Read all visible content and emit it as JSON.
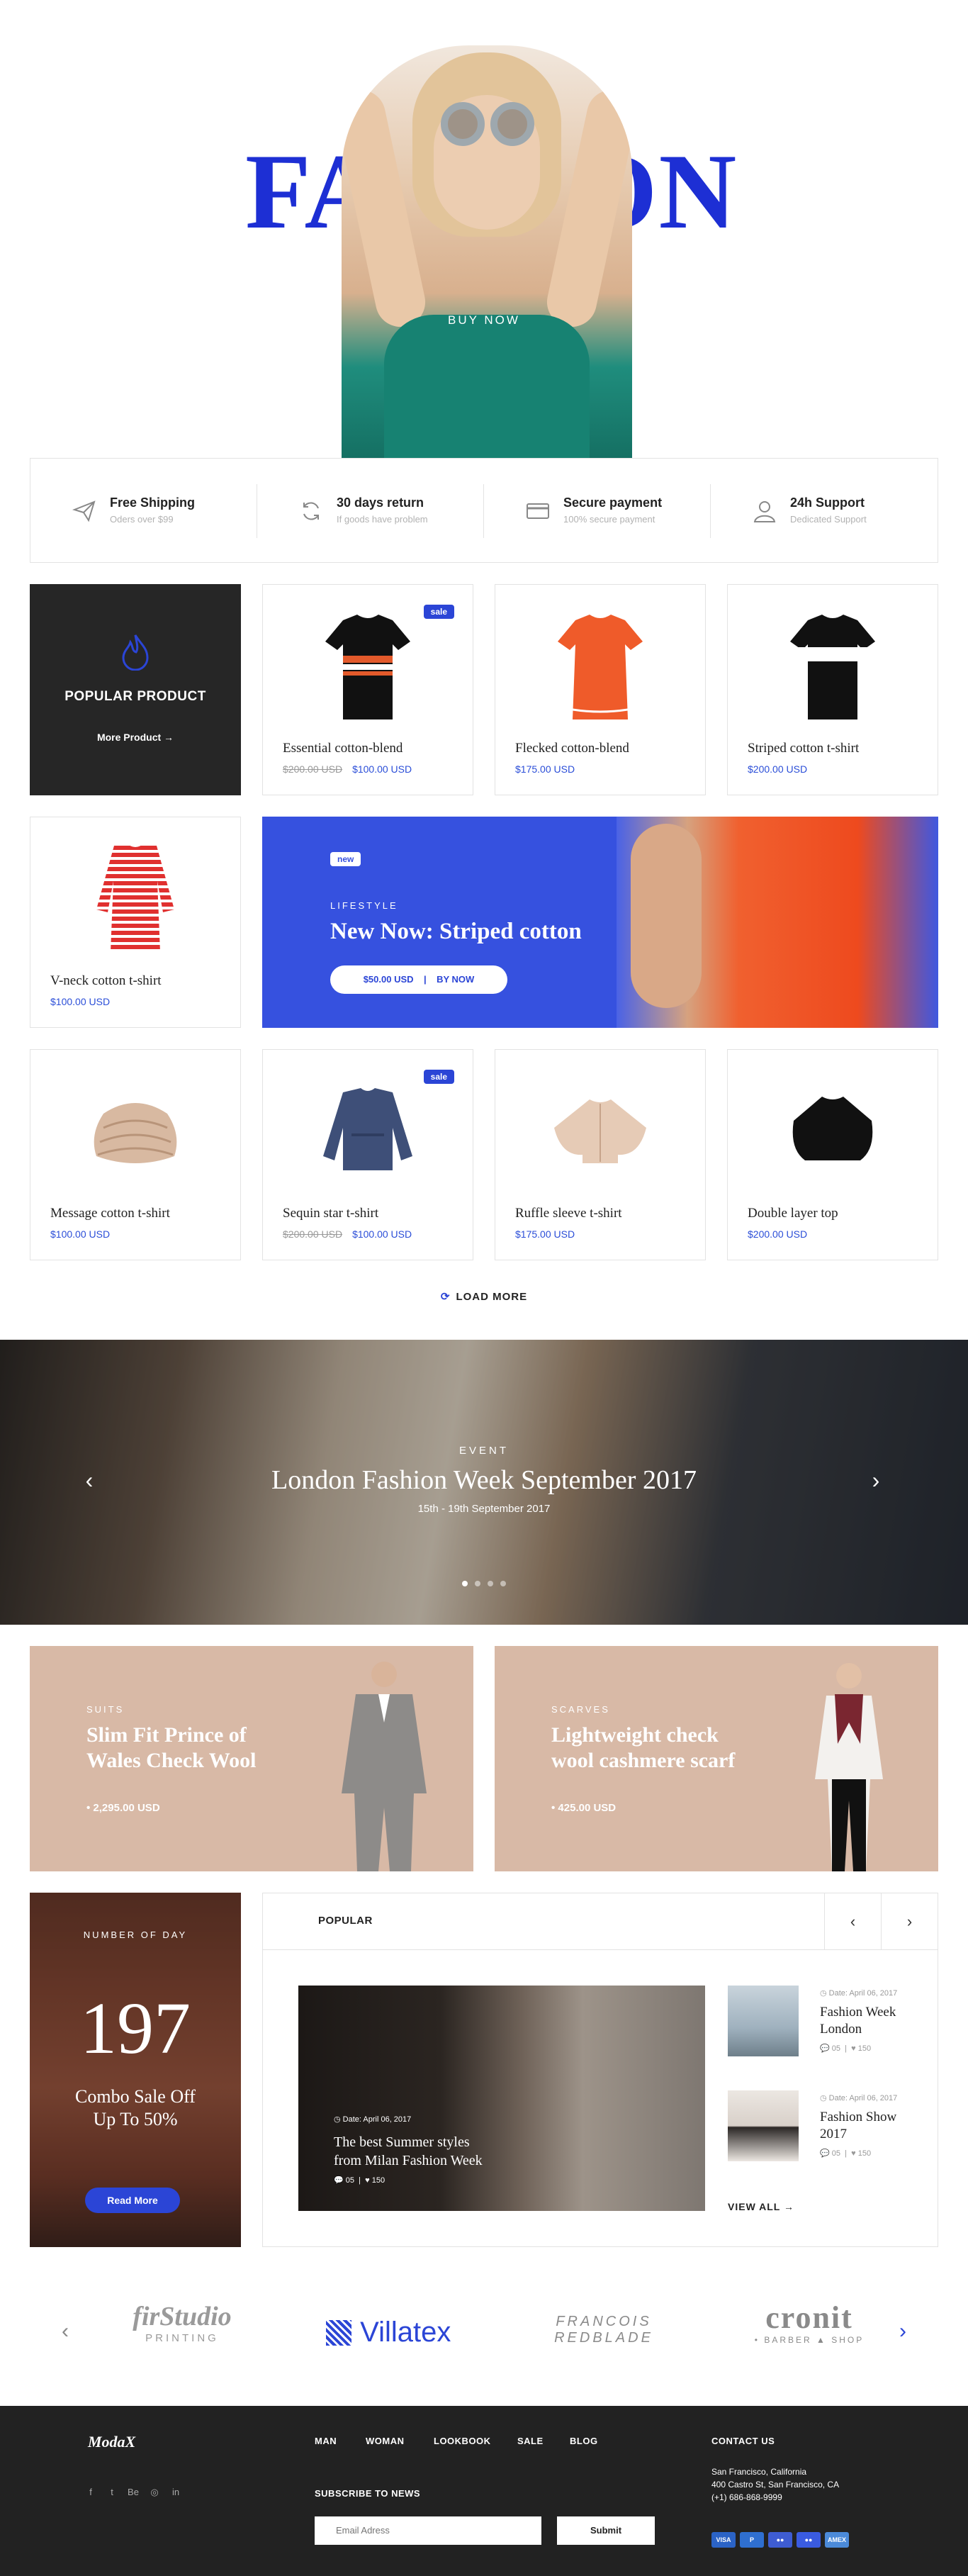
{
  "hero": {
    "word": "FASHION",
    "cta": "BUY NOW"
  },
  "features": [
    {
      "icon": "paper-plane-icon",
      "title": "Free Shipping",
      "sub": "Oders over $99"
    },
    {
      "icon": "refresh-icon",
      "title": "30 days return",
      "sub": "If goods have problem"
    },
    {
      "icon": "credit-card-icon",
      "title": "Secure payment",
      "sub": "100% secure payment"
    },
    {
      "icon": "user-support-icon",
      "title": "24h Support",
      "sub": "Dedicated Support"
    }
  ],
  "popular": {
    "title": "POPULAR PRODUCT",
    "link": "More Product  →"
  },
  "products": [
    {
      "name": "Essential cotton-blend",
      "old": "$200.00 USD",
      "price": "$100.00 USD",
      "badge": "sale",
      "color": "#111111",
      "stripe": "#e35a2b"
    },
    {
      "name": "Flecked cotton-blend",
      "old": "",
      "price": "$175.00 USD",
      "badge": "",
      "color": "#ef5b2a",
      "stripe": "#ef5b2a"
    },
    {
      "name": "Striped cotton t-shirt",
      "old": "",
      "price": "$200.00 USD",
      "badge": "",
      "color": "#111111",
      "stripe": "#ffffff"
    },
    {
      "name": "V-neck cotton t-shirt",
      "old": "",
      "price": "$100.00 USD",
      "badge": "",
      "color": "#e0302f",
      "stripe": "#ffffff"
    },
    {
      "name": "Message cotton t-shirt",
      "old": "",
      "price": "$100.00 USD",
      "badge": "",
      "color": "#d8b9a1",
      "stripe": "#c7a48a"
    },
    {
      "name": "Sequin star t-shirt",
      "old": "$200.00 USD",
      "price": "$100.00 USD",
      "badge": "sale",
      "color": "#3e4f78",
      "stripe": "#2f3d60"
    },
    {
      "name": "Ruffle sleeve t-shirt",
      "old": "",
      "price": "$175.00 USD",
      "badge": "",
      "color": "#e6cbb6",
      "stripe": "#d2b29a"
    },
    {
      "name": "Double layer top",
      "old": "",
      "price": "$200.00 USD",
      "badge": "",
      "color": "#111111",
      "stripe": "#111111"
    }
  ],
  "lifestyle": {
    "tag": "new",
    "label": "LIFESTYLE",
    "title": "New Now: Striped cotton",
    "price": "$50.00 USD",
    "sep": "|",
    "cta": "BY NOW"
  },
  "load_more": "LOAD MORE",
  "slider": {
    "label": "EVENT",
    "title": "London Fashion Week September 2017",
    "date": "15th - 19th September 2017",
    "prev": "‹",
    "next": "›"
  },
  "promos": [
    {
      "cat": "SUITS",
      "title": "Slim Fit Prince of Wales Check Wool",
      "price": "• 2,295.00 USD"
    },
    {
      "cat": "SCARVES",
      "title": "Lightweight check wool cashmere scarf",
      "price": "• 425.00 USD"
    }
  ],
  "deal": {
    "label": "NUMBER OF DAY",
    "number": "197",
    "sub1": "Combo Sale Off",
    "sub2": "Up To 50%",
    "cta": "Read More"
  },
  "blog": {
    "title": "POPULAR",
    "prev": "‹",
    "next": "›",
    "featured": {
      "date": "Date: April 06, 2017",
      "title": "The best Summer styles from Milan Fashion Week",
      "comments": "05",
      "likes": "150"
    },
    "side": [
      {
        "date": "Date: April 06, 2017",
        "title": "Fashion Week London",
        "comments": "05",
        "likes": "150"
      },
      {
        "date": "Date: April 06, 2017",
        "title": "Fashion Show 2017",
        "comments": "05",
        "likes": "150"
      }
    ],
    "view_all": "VIEW ALL  →"
  },
  "brands": {
    "prev": "‹",
    "next": "›",
    "items": [
      {
        "line1": "firStudio",
        "line2": "PRINTING"
      },
      {
        "line1": "Villatex",
        "line2": ""
      },
      {
        "line1": "FRANCOIS",
        "line2": "REDBLADE"
      },
      {
        "line1": "cronit",
        "line2": "• BARBER ▲ SHOP"
      }
    ]
  },
  "footer": {
    "logo": "ModaX",
    "social": [
      "f",
      "t",
      "Be",
      "◎",
      "in"
    ],
    "nav": [
      "MAN",
      "WOMAN",
      "LOOKBOOK",
      "SALE",
      "BLOG"
    ],
    "subscribe_label": "SUBSCRIBE TO NEWS",
    "email_placeholder": "Email Adress",
    "submit": "Submit",
    "contact_title": "CONTACT US",
    "contact_lines": [
      "San Francisco, California",
      "400 Castro St, San Francisco, CA",
      "(+1) 686-868-9999"
    ],
    "payments": [
      {
        "label": "VISA",
        "color": "#2b63c6"
      },
      {
        "label": "P",
        "color": "#2f6fd0"
      },
      {
        "label": "●●",
        "color": "#3e5cd2"
      },
      {
        "label": "●●",
        "color": "#3a5be0"
      },
      {
        "label": "AMEX",
        "color": "#4b8ad9"
      }
    ]
  },
  "colors": {
    "accent": "#2b45d6",
    "dark": "#262626",
    "promo": "#d8b9a6"
  }
}
